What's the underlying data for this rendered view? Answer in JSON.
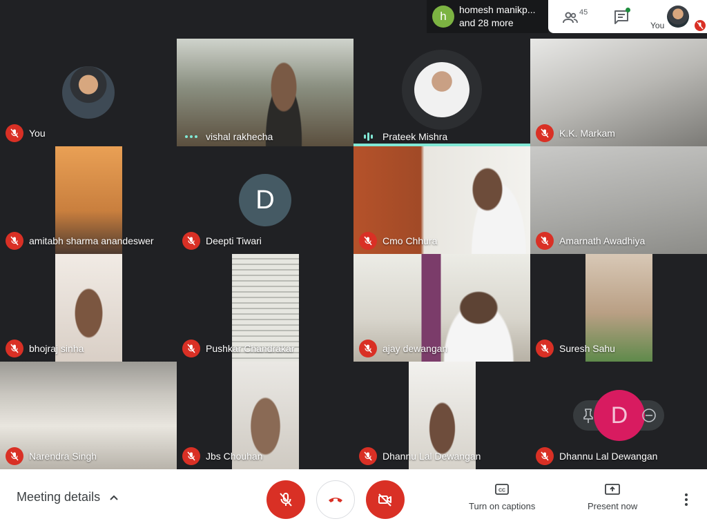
{
  "topbar": {
    "presenter_initial": "h",
    "presenter_name": "homesh manikp...",
    "presenter_more": "and 28 more",
    "people_count": "45",
    "self_label": "You"
  },
  "tiles": [
    {
      "name": "You",
      "status": "muted"
    },
    {
      "name": "vishal rakhecha",
      "status": "speaking-dots"
    },
    {
      "name": "Prateek Mishra",
      "status": "talking"
    },
    {
      "name": "K.K. Markam",
      "status": "muted"
    },
    {
      "name": "amitabh sharma anandeswer",
      "status": "muted"
    },
    {
      "name": "Deepti Tiwari",
      "status": "muted",
      "initial": "D"
    },
    {
      "name": "Cmo Chhura",
      "status": "muted"
    },
    {
      "name": "Amarnath Awadhiya",
      "status": "muted"
    },
    {
      "name": "bhojraj sinha",
      "status": "muted"
    },
    {
      "name": "Pushkar Chandrakar",
      "status": "muted"
    },
    {
      "name": "ajay dewangan",
      "status": "muted"
    },
    {
      "name": "Suresh Sahu",
      "status": "muted"
    },
    {
      "name": "Narendra Singh",
      "status": "muted"
    },
    {
      "name": "Jbs Chouhan",
      "status": "muted"
    },
    {
      "name": "Dhannu Lal Dewangan",
      "status": "muted"
    },
    {
      "name": "Dhannu Lal Dewangan",
      "status": "muted"
    }
  ],
  "self_view": {
    "initial": "D"
  },
  "bottombar": {
    "meeting_details": "Meeting details",
    "captions": "Turn on captions",
    "present": "Present now"
  },
  "colors": {
    "accent": "#81e8d5",
    "danger": "#d93025",
    "self_avatar": "#d81b60"
  }
}
